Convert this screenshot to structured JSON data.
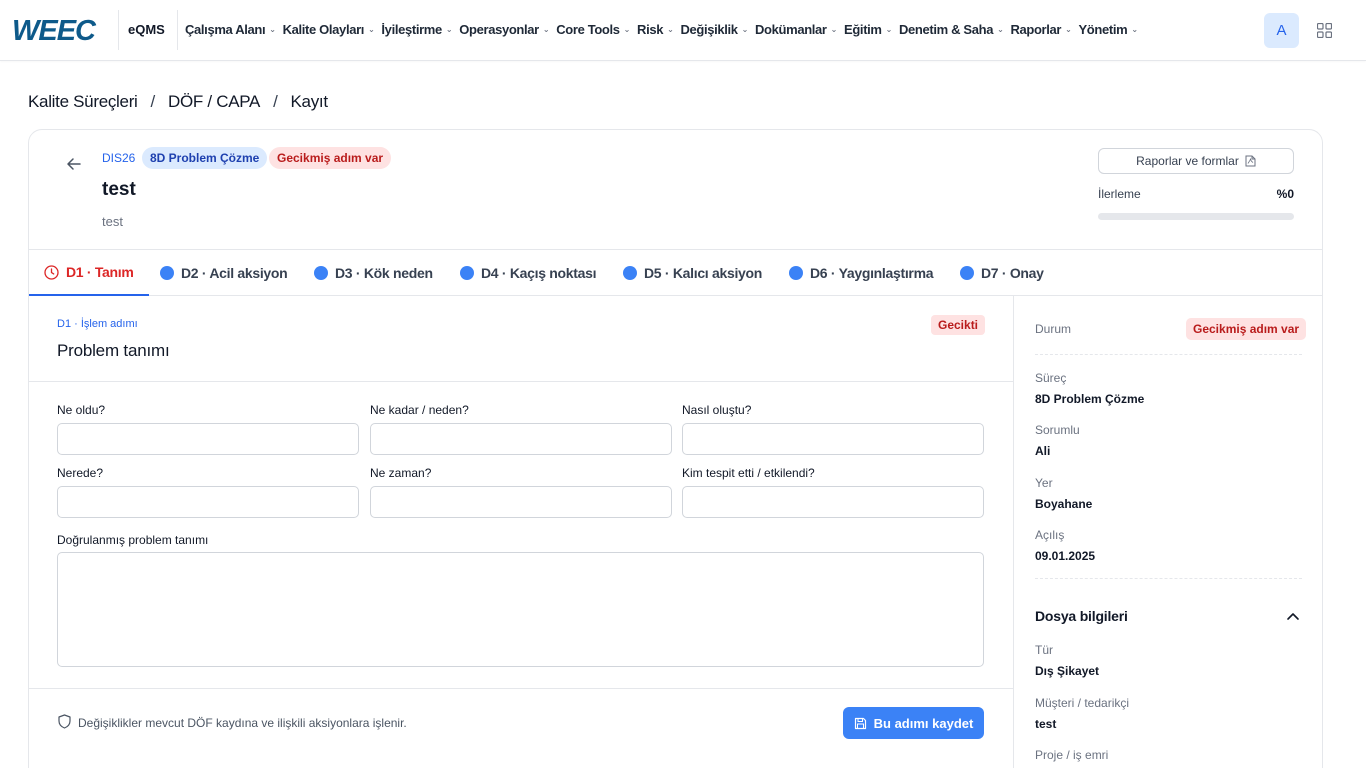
{
  "brand": {
    "logo_text": "WEEC",
    "product": "eQMS",
    "primary_color": "#2563eb"
  },
  "nav": {
    "items": [
      {
        "label": "Çalışma Alanı"
      },
      {
        "label": "Kalite Olayları"
      },
      {
        "label": "İyileştirme"
      },
      {
        "label": "Operasyonlar"
      },
      {
        "label": "Core Tools"
      },
      {
        "label": "Risk"
      },
      {
        "label": "Değişiklik"
      },
      {
        "label": "Dokümanlar"
      },
      {
        "label": "Eğitim"
      },
      {
        "label": "Denetim & Saha"
      },
      {
        "label": "Raporlar"
      },
      {
        "label": "Yönetim"
      }
    ],
    "avatar_initial": "A",
    "apps_icon": "grid-icon"
  },
  "breadcrumb": {
    "items": [
      "Kalite Süreçleri",
      "DÖF / CAPA",
      "Kayıt"
    ],
    "separator": "/"
  },
  "record": {
    "code": "DIS26",
    "type_badge": "8D Problem Çözme",
    "status_badge": "Gecikmiş adım var",
    "title": "test",
    "description": "test",
    "reports_button": "Raporlar ve formlar",
    "progress_label": "İlerleme",
    "progress_value": "%0",
    "progress_fraction": 0
  },
  "tabs": [
    {
      "label": "D1 · Tanım",
      "active": true
    },
    {
      "label": "D2 · Acil aksiyon"
    },
    {
      "label": "D3 · Kök neden"
    },
    {
      "label": "D4 · Kaçış noktası"
    },
    {
      "label": "D5 · Kalıcı aksiyon"
    },
    {
      "label": "D6 · Yaygınlaştırma"
    },
    {
      "label": "D7 · Onay"
    }
  ],
  "step": {
    "label": "D1 · İşlem adımı",
    "title": "Problem tanımı",
    "late_badge": "Gecikti",
    "fields": [
      {
        "label": "Ne oldu?",
        "value": ""
      },
      {
        "label": "Ne kadar / neden?",
        "value": ""
      },
      {
        "label": "Nasıl oluştu?",
        "value": ""
      },
      {
        "label": "Nerede?",
        "value": ""
      },
      {
        "label": "Ne zaman?",
        "value": ""
      },
      {
        "label": "Kim tespit etti / etkilendi?",
        "value": ""
      }
    ],
    "verified_label": "Doğrulanmış problem tanımı",
    "verified_value": "",
    "footer_note": "Değişiklikler mevcut DÖF kaydına ve ilişkili aksiyonlara işlenir.",
    "save_button": "Bu adımı kaydet"
  },
  "side": {
    "status_label": "Durum",
    "status_badge": "Gecikmiş adım var",
    "process_label": "Süreç",
    "process_value": "8D Problem Çözme",
    "owner_label": "Sorumlu",
    "owner_value": "Ali",
    "place_label": "Yer",
    "place_value": "Boyahane",
    "opened_label": "Açılış",
    "opened_value": "09.01.2025",
    "file_section": "Dosya bilgileri",
    "type_label": "Tür",
    "type_value": "Dış Şikayet",
    "customer_label": "Müşteri / tedarikçi",
    "customer_value": "test",
    "project_label": "Proje / iş emri"
  }
}
